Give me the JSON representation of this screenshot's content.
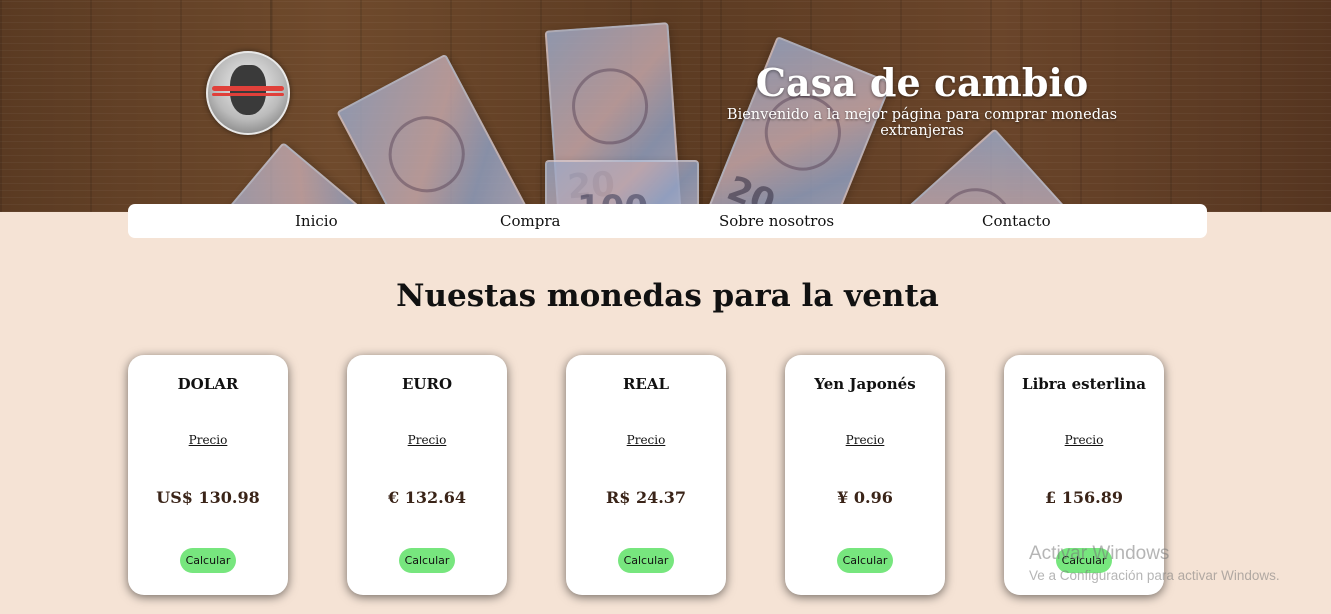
{
  "header": {
    "title": "Casa de cambio",
    "subtitle": "Bienvenido a la mejor página para comprar monedas extranjeras",
    "banknote_labels": [
      "20",
      "20",
      "20",
      "20",
      "100"
    ]
  },
  "nav": {
    "items": [
      {
        "label": "Inicio"
      },
      {
        "label": "Compra"
      },
      {
        "label": "Sobre nosotros"
      },
      {
        "label": "Contacto"
      }
    ]
  },
  "main": {
    "title": "Nuestas monedas para la venta",
    "cards": [
      {
        "name": "DOLAR",
        "price_label": "Precio",
        "price": "US$ 130.98",
        "button": "Calcular"
      },
      {
        "name": "EURO",
        "price_label": "Precio",
        "price": "€ 132.64",
        "button": "Calcular"
      },
      {
        "name": "REAL",
        "price_label": "Precio",
        "price": "R$ 24.37",
        "button": "Calcular"
      },
      {
        "name": "Yen Japonés",
        "price_label": "Precio",
        "price": "¥ 0.96",
        "button": "Calcular"
      },
      {
        "name": "Libra esterlina",
        "price_label": "Precio",
        "price": "£ 156.89",
        "button": "Calcular"
      }
    ]
  },
  "watermark": {
    "line1": "Activar Windows",
    "line2": "Ve a Configuración para activar Windows."
  },
  "colors": {
    "page_background": "#f5e3d5",
    "button": "#77e67e",
    "price_text": "#3a2418"
  }
}
